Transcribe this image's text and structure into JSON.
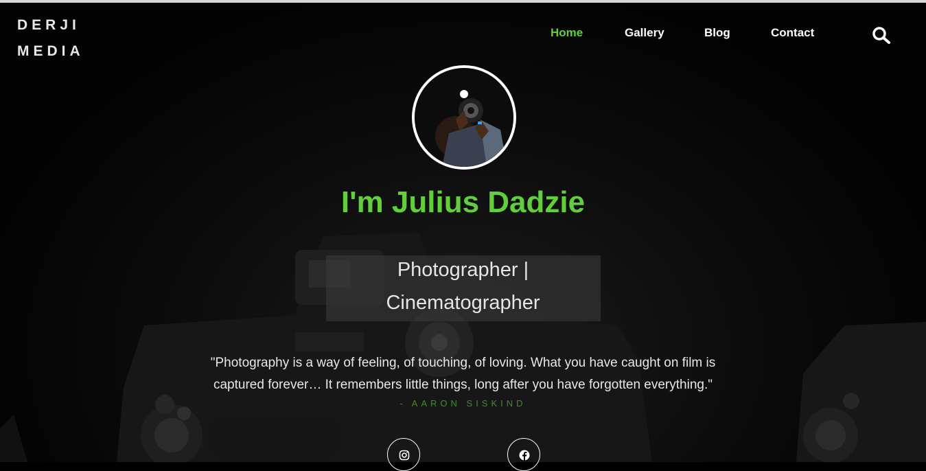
{
  "brand": {
    "line1": "DERJI",
    "line2": "MEDIA"
  },
  "nav": {
    "items": [
      {
        "label": "Home",
        "active": true
      },
      {
        "label": "Gallery",
        "active": false
      },
      {
        "label": "Blog",
        "active": false
      },
      {
        "label": "Contact",
        "active": false
      }
    ],
    "search_icon": "search-icon"
  },
  "hero": {
    "avatar_icon": "photographer-avatar",
    "heading": "I'm Julius Dadzie",
    "role_line1": "Photographer |",
    "role_line2": "Cinematographer",
    "quote_line1": "\"Photography is a way of feeling, of touching, of loving. What you have caught on film is",
    "quote_line2": "captured forever… It remembers little things, long after you have forgotten everything.\"",
    "quote_author": "- AARON SISKIND"
  },
  "social": [
    {
      "icon": "instagram-icon"
    },
    {
      "icon": "facebook-icon"
    }
  ],
  "colors": {
    "accent": "#61ce3c",
    "author": "#3d8f2a",
    "background": "#000000"
  }
}
